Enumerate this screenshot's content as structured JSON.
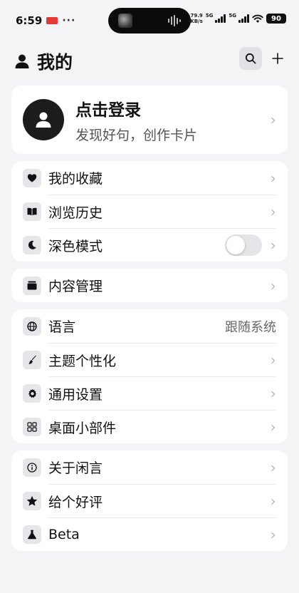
{
  "status_bar": {
    "time": "6:59",
    "dots": "···",
    "speed_top": "79.9",
    "speed_bottom": "KB/s",
    "sig1_label": "5G",
    "sig2_label": "5G",
    "battery": "90"
  },
  "header": {
    "title": "我的",
    "icons": {
      "user": "user-icon",
      "search": "search-icon",
      "add": "plus-icon"
    }
  },
  "profile": {
    "title": "点击登录",
    "subtitle": "发现好句，创作卡片"
  },
  "groups": [
    {
      "items": [
        {
          "label": "我的收藏",
          "icon": "heart-icon"
        },
        {
          "label": "浏览历史",
          "icon": "book-icon"
        },
        {
          "label": "深色模式",
          "icon": "moon-icon",
          "toggle": false
        }
      ]
    },
    {
      "items": [
        {
          "label": "内容管理",
          "icon": "archive-icon"
        }
      ]
    },
    {
      "items": [
        {
          "label": "语言",
          "icon": "globe-icon",
          "value": "跟随系统"
        },
        {
          "label": "主题个性化",
          "icon": "brush-icon"
        },
        {
          "label": "通用设置",
          "icon": "gear-icon"
        },
        {
          "label": "桌面小部件",
          "icon": "widgets-icon"
        }
      ]
    },
    {
      "items": [
        {
          "label": "关于闲言",
          "icon": "info-icon"
        },
        {
          "label": "给个好评",
          "icon": "star-icon"
        },
        {
          "label": "Beta",
          "icon": "flask-icon"
        }
      ]
    }
  ],
  "colors": {
    "background": "#f4f4f6",
    "card": "#ffffff",
    "accent": "#111111",
    "status_badge": "#e53935"
  }
}
